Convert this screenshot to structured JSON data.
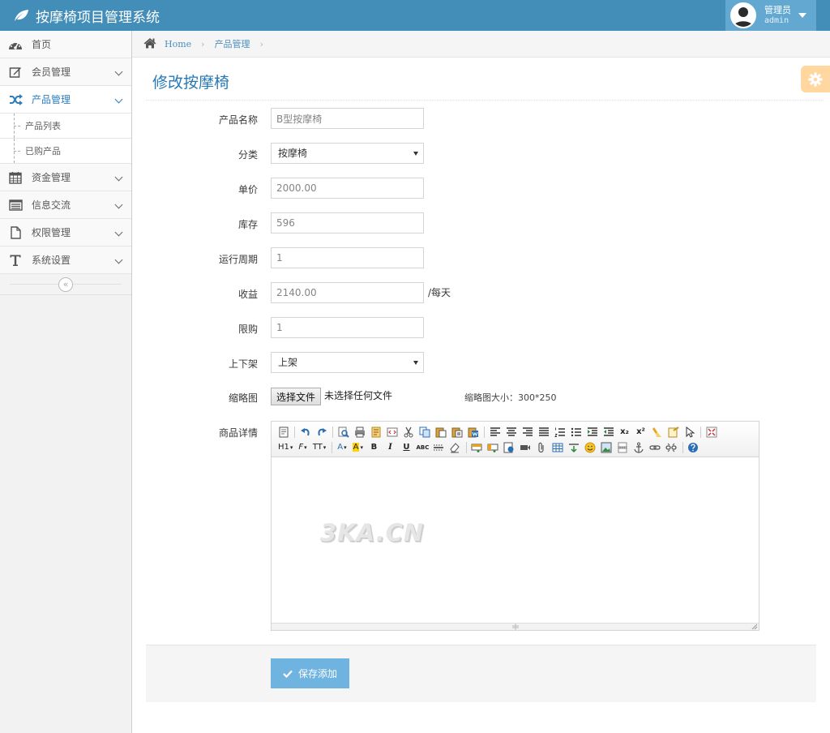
{
  "app": {
    "title": "按摩椅项目管理系统"
  },
  "user": {
    "role": "管理员",
    "name": "admin"
  },
  "sidebar": {
    "items": [
      {
        "label": "首页"
      },
      {
        "label": "会员管理"
      },
      {
        "label": "产品管理"
      },
      {
        "label": "资金管理"
      },
      {
        "label": "信息交流"
      },
      {
        "label": "权限管理"
      },
      {
        "label": "系统设置"
      }
    ],
    "subitems": [
      {
        "label": "产品列表"
      },
      {
        "label": "已购产品"
      }
    ],
    "collapse_glyph": "«"
  },
  "breadcrumb": {
    "home": "Home",
    "current": "产品管理"
  },
  "page": {
    "title": "修改按摩椅"
  },
  "form": {
    "name": {
      "label": "产品名称",
      "value": "B型按摩椅"
    },
    "category": {
      "label": "分类",
      "value": "按摩椅"
    },
    "price": {
      "label": "单价",
      "value": "2000.00"
    },
    "stock": {
      "label": "库存",
      "value": "596"
    },
    "cycle": {
      "label": "运行周期",
      "value": "1"
    },
    "income": {
      "label": "收益",
      "value": "2140.00",
      "suffix": "/每天"
    },
    "limit": {
      "label": "限购",
      "value": "1"
    },
    "shelf": {
      "label": "上下架",
      "value": "上架"
    },
    "thumbnail": {
      "label": "缩略图",
      "button": "选择文件",
      "status": "未选择任何文件",
      "hint": "缩略图大小：300*250"
    },
    "detail": {
      "label": "商品详情"
    }
  },
  "editor": {
    "heading_label": "H1",
    "font_family_label": "F",
    "font_size_label": "TT",
    "font_color_label": "A",
    "bg_color_label": "A",
    "bold": "B",
    "italic": "I",
    "underline": "U",
    "strike": "ABC",
    "superscript": "x²",
    "subscript": "x₂",
    "watermark": "3KA.CN"
  },
  "actions": {
    "save": "保存添加"
  },
  "colors": {
    "navbar": "#438eb9",
    "title": "#2679b5",
    "save": "#6fb3e0",
    "settings": "#ffb752"
  }
}
